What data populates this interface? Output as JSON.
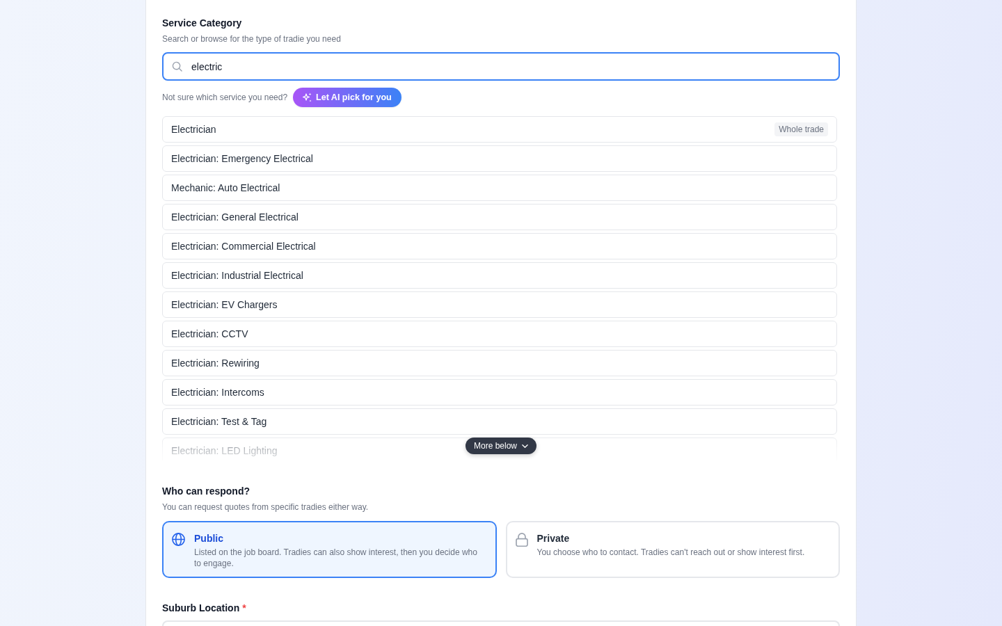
{
  "service_category": {
    "label": "Service Category",
    "hint": "Search or browse for the type of tradie you need",
    "search": {
      "value": "electric",
      "focused": true
    },
    "ai_prompt": {
      "text": "Not sure which service you need?",
      "button": "Let AI pick for you"
    },
    "results": [
      {
        "label": "Electrician",
        "badge": "Whole trade",
        "selected": false
      },
      {
        "label": "Electrician: Emergency Electrical",
        "selected": false
      },
      {
        "label": "Mechanic: Auto Electrical",
        "selected": false
      },
      {
        "label": "Electrician: General Electrical",
        "selected": false
      },
      {
        "label": "Electrician: Commercial Electrical",
        "selected": false
      },
      {
        "label": "Electrician: Industrial Electrical",
        "selected": false
      },
      {
        "label": "Electrician: EV Chargers",
        "selected": false
      },
      {
        "label": "Electrician: CCTV",
        "selected": false
      },
      {
        "label": "Electrician: Rewiring",
        "selected": false
      },
      {
        "label": "Electrician: Intercoms",
        "selected": false
      },
      {
        "label": "Electrician: Test & Tag",
        "selected": false
      },
      {
        "label": "Electrician: LED Lighting",
        "selected": false
      }
    ],
    "more_below": "More below"
  },
  "response_type": {
    "label": "Who can respond?",
    "hint": "You can request quotes from specific tradies either way.",
    "options": [
      {
        "kind": "public",
        "title": "Public",
        "description": "Listed on the job board. Tradies can also show interest, then you decide who to engage.",
        "selected": true
      },
      {
        "kind": "private",
        "title": "Private",
        "description": "You choose who to contact. Tradies can't reach out or show interest first.",
        "selected": false
      }
    ]
  },
  "suburb_location": {
    "label": "Suburb Location",
    "required_mark": "*"
  }
}
